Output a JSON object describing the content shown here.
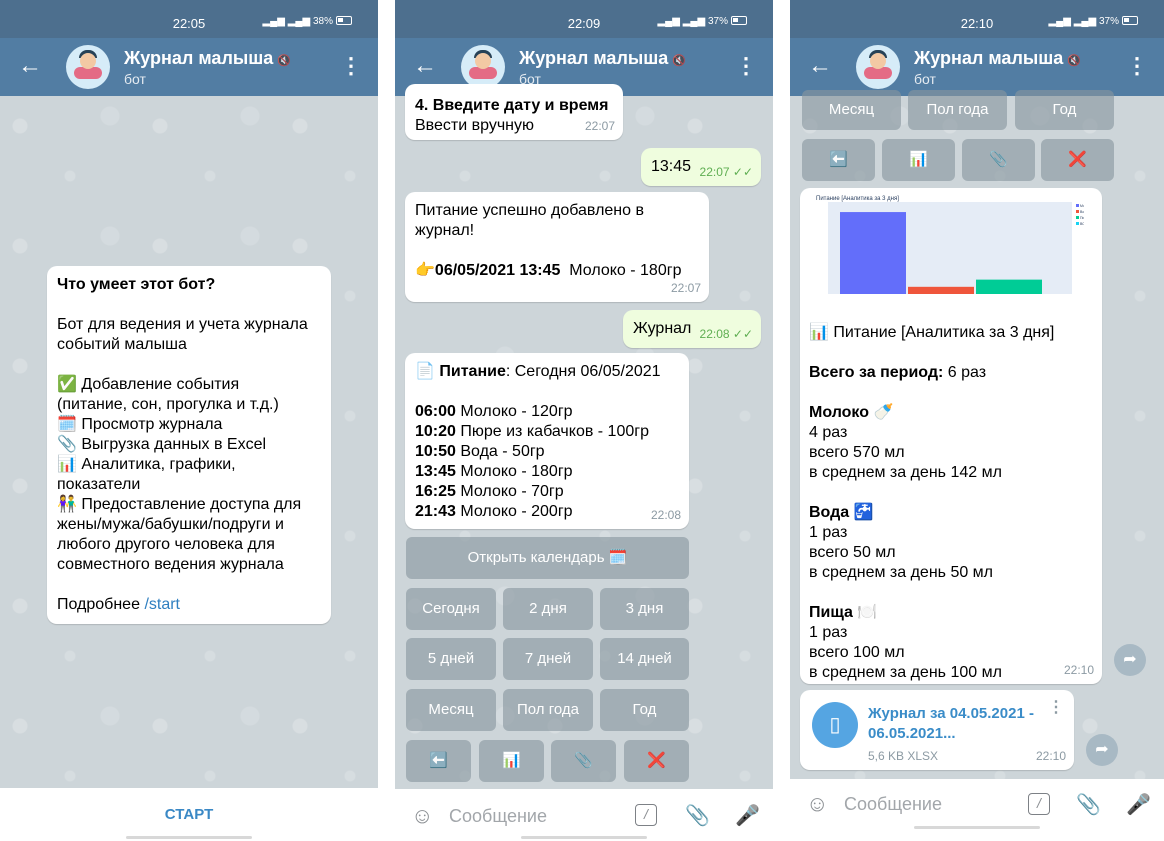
{
  "chat": {
    "name": "Журнал малыша",
    "subtitle": "бот"
  },
  "screens": {
    "s1": {
      "time": "22:05",
      "battery": "38%"
    },
    "s2": {
      "time": "22:09",
      "battery": "37%"
    },
    "s3": {
      "time": "22:10",
      "battery": "37%"
    }
  },
  "intro": {
    "title": "Что умеет этот бот?",
    "desc1": "Бот для ведения и учета журнала",
    "desc2": "событий малыша",
    "f1a": "✅ Добавление события",
    "f1b": "(питание, сон, прогулка и т.д.)",
    "f2": "🗓️ Просмотр журнала",
    "f3": "📎 Выгрузка данных в Excel",
    "f4a": "📊 Аналитика, графики,",
    "f4b": "показатели",
    "f5a": "👫 Предоставление доступа для",
    "f5b": "жены/мужа/бабушки/подруги и",
    "f5c": "любого другого человека для",
    "f5d": "совместного ведения журнала",
    "more": "Подробнее",
    "more_link": "/start"
  },
  "start_button": "СТАРТ",
  "s2": {
    "m1_bold": "4. Введите дату и время",
    "m1_text": "Ввести вручную",
    "m1_time": "22:07",
    "m2_text": "13:45",
    "m2_time": "22:07",
    "m3_l1": "Питание успешно добавлено в",
    "m3_l2": "журнал!",
    "m3_l3_bold": "👉06/05/2021 13:45",
    "m3_l3_rest": "Молоко - 180гр",
    "m3_time": "22:07",
    "m4_text": "Журнал",
    "m4_time": "22:08",
    "m5_title_bold": "📄 Питание",
    "m5_title_rest": ": Сегодня 06/05/2021",
    "m5_time": "22:08",
    "entries": [
      {
        "time": "06:00",
        "item": "Молоко - 120гр"
      },
      {
        "time": "10:20",
        "item": "Пюре из кабачков - 100гр"
      },
      {
        "time": "10:50",
        "item": "Вода - 50гр"
      },
      {
        "time": "13:45",
        "item": "Молоко - 180гр"
      },
      {
        "time": "16:25",
        "item": "Молоко - 70гр"
      },
      {
        "time": "21:43",
        "item": "Молоко - 200гр"
      }
    ],
    "kb": {
      "calendar": "Открыть календарь 🗓️",
      "today": "Сегодня",
      "d2": "2 дня",
      "d3": "3 дня",
      "d5": "5 дней",
      "d7": "7 дней",
      "d14": "14 дней",
      "month": "Месяц",
      "half": "Пол года",
      "year": "Год",
      "back": "⬅️",
      "chart": "📊",
      "clip": "📎",
      "close": "❌"
    }
  },
  "s3": {
    "kb": {
      "month": "Месяц",
      "half": "Пол года",
      "year": "Год",
      "back": "⬅️",
      "chart": "📊",
      "clip": "📎",
      "close": "❌"
    },
    "chart_title": "Питание [Аналитика за 3 дня]",
    "caption": "📊 Питание [Аналитика за 3 дня]",
    "period_bold": "Всего за период:",
    "period_rest": "6 раз",
    "milk_h": "Молоко 🍼",
    "milk_1": "4 раз",
    "milk_2": "всего 570 мл",
    "milk_3": "в среднем за день 142 мл",
    "water_h": "Вода 🚰",
    "water_1": "1 раз",
    "water_2": "всего 50 мл",
    "water_3": "в среднем за день 50 мл",
    "food_h": "Пища 🍽️",
    "food_1": "1 раз",
    "food_2": "всего 100 мл",
    "food_3": "в среднем за день 100 мл",
    "msg_time": "22:10",
    "file_name1": "Журнал за 04.05.2021 -",
    "file_name2": "06.05.2021...",
    "file_meta": "5,6 KB XLSX",
    "file_time": "22:10"
  },
  "input_placeholder": "Сообщение",
  "chart_data": {
    "type": "bar",
    "title": "Питание [Аналитика за 3 дня]",
    "categories": [
      "Молоко",
      "Вода",
      "Пища"
    ],
    "values": [
      570,
      50,
      100
    ],
    "colors": [
      "#636efa",
      "#ef553b",
      "#00cc96"
    ],
    "legend": [
      "Молоко",
      "Вода",
      "Пища",
      "ВОДЫ"
    ]
  }
}
